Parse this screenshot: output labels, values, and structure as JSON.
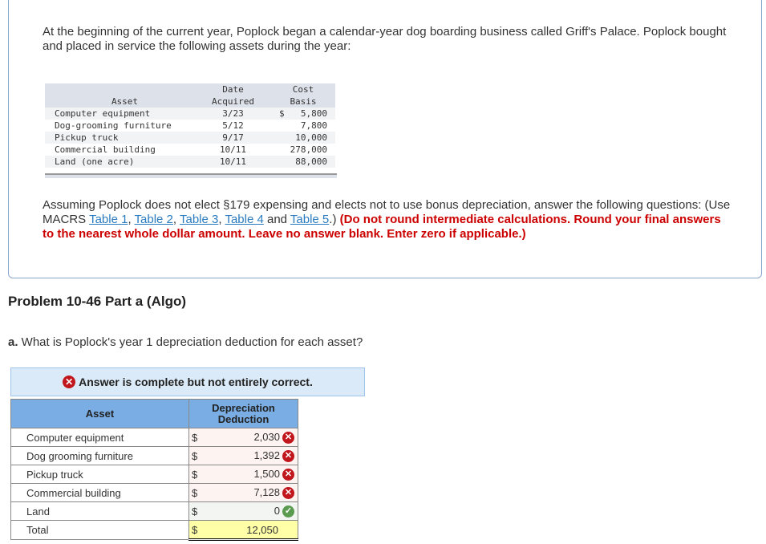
{
  "intro": "At the beginning of the current year, Poplock began a calendar-year dog boarding business called Griff's Palace. Poplock bought and placed in service the following assets during the year:",
  "given": {
    "headers": [
      "Asset",
      "Date\nAcquired",
      "Cost\nBasis"
    ],
    "h_date": [
      "Date",
      "Acquired"
    ],
    "h_cost": [
      "Cost",
      "Basis"
    ],
    "currency": "$",
    "rows": [
      {
        "asset": "Computer equipment",
        "date": "3/23",
        "cost": "5,800"
      },
      {
        "asset": "Dog-grooming furniture",
        "date": "5/12",
        "cost": "7,800"
      },
      {
        "asset": "Pickup truck",
        "date": "9/17",
        "cost": "10,000"
      },
      {
        "asset": "Commercial building",
        "date": "10/11",
        "cost": "278,000"
      },
      {
        "asset": "Land (one acre)",
        "date": "10/11",
        "cost": "88,000"
      }
    ]
  },
  "instructions": {
    "text1": "Assuming Poplock does not elect §179 expensing and elects not to use bonus depreciation, answer the following questions: (Use MACRS ",
    "links": [
      "Table 1",
      "Table 2",
      "Table 3",
      "Table 4",
      "Table 5"
    ],
    "sep1": ", ",
    "sep2": ", ",
    "sep3": ", ",
    "sep4": " and ",
    "text2": ".) ",
    "bold": "(Do not round intermediate calculations. Round your final answers to the nearest whole dollar amount. Leave no answer blank. Enter zero if applicable.)"
  },
  "problem_title": "Problem 10-46 Part a (Algo)",
  "question": {
    "label": "a.",
    "text": " What is Poplock's year 1 depreciation deduction for each asset?"
  },
  "banner": "Answer is complete but not entirely correct.",
  "answer": {
    "h_asset": "Asset",
    "h_dep": "Depreciation Deduction",
    "currency": "$",
    "rows": [
      {
        "asset": "Computer equipment",
        "value": "2,030",
        "status": "incorrect"
      },
      {
        "asset": "Dog grooming furniture",
        "value": "1,392",
        "status": "incorrect"
      },
      {
        "asset": "Pickup truck",
        "value": "1,500",
        "status": "incorrect"
      },
      {
        "asset": "Commercial building",
        "value": "7,128",
        "status": "incorrect"
      },
      {
        "asset": "Land",
        "value": "0",
        "status": "correct"
      }
    ],
    "total_label": "Total",
    "total": "12,050"
  },
  "colors": {
    "incorrect": "#c0161c",
    "correct": "#5a9b4f",
    "header": "#79ade3",
    "link": "#2a7bc0",
    "alert": "#cc0000"
  }
}
